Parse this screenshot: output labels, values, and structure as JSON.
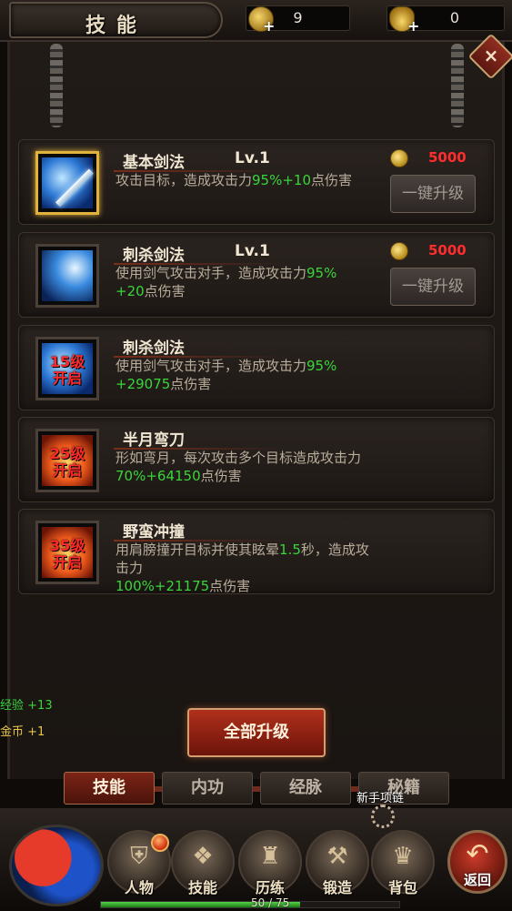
{
  "header": {
    "title": "技能",
    "copper": "9",
    "gold": "0"
  },
  "skills": [
    {
      "name": "基本剑法",
      "level": "Lv.1",
      "desc_pre": "攻击目标，造成攻击力",
      "desc_hl1": "95%+10",
      "desc_mid": "点伤害",
      "cost": "5000",
      "upgrade_label": "一键升级",
      "locked": false,
      "selected": true
    },
    {
      "name": "刺杀剑法",
      "level": "Lv.1",
      "desc_pre": "使用剑气攻击对手，造成攻击力",
      "desc_hl1": "95%",
      "desc_hl2": "+20",
      "desc_mid": "点伤害",
      "cost": "5000",
      "upgrade_label": "一键升级",
      "locked": false,
      "selected": false
    },
    {
      "name": "刺杀剑法",
      "lock_text": "15级\n开启",
      "desc_pre": "使用剑气攻击对手，造成攻击力",
      "desc_hl1": "95%",
      "desc_hl2": "+29075",
      "desc_mid": "点伤害",
      "locked": true
    },
    {
      "name": "半月弯刀",
      "lock_text": "25级\n开启",
      "desc_pre": "形如弯月，每次攻击多个目标造成攻击力",
      "desc_hl1": "70%+64150",
      "desc_mid": "点伤害",
      "locked": true
    },
    {
      "name": "野蛮冲撞",
      "lock_text": "35级\n开启",
      "desc_pre": "用肩膀撞开目标并使其眩晕",
      "desc_hl1": "1.5",
      "desc_mid1": "秒，造成攻击力",
      "desc_hl2": "100%+21175",
      "desc_mid": "点伤害",
      "locked": true
    }
  ],
  "log": {
    "exp_label": "经验",
    "exp_value": "+13",
    "gold_label": "金币",
    "gold_value": "+1"
  },
  "actions": {
    "upgrade_all": "全部升级"
  },
  "tabs": [
    {
      "label": "技能",
      "active": true
    },
    {
      "label": "内功",
      "active": false
    },
    {
      "label": "经脉",
      "active": false
    },
    {
      "label": "秘籍",
      "active": false
    }
  ],
  "newbie": {
    "label": "新手项链"
  },
  "nav": {
    "items": [
      {
        "label": "人物",
        "icon": "armor-icon"
      },
      {
        "label": "技能",
        "icon": "skill-book-icon"
      },
      {
        "label": "历练",
        "icon": "helmet-icon"
      },
      {
        "label": "锻造",
        "icon": "hammer-icon"
      },
      {
        "label": "背包",
        "icon": "bag-icon"
      }
    ],
    "back": "返回"
  },
  "xp": {
    "text": "50 / 75",
    "current": 50,
    "max": 75
  },
  "colors": {
    "highlight": "#39d53a",
    "cost": "#ff2d2d",
    "accent": "#b0301c"
  }
}
